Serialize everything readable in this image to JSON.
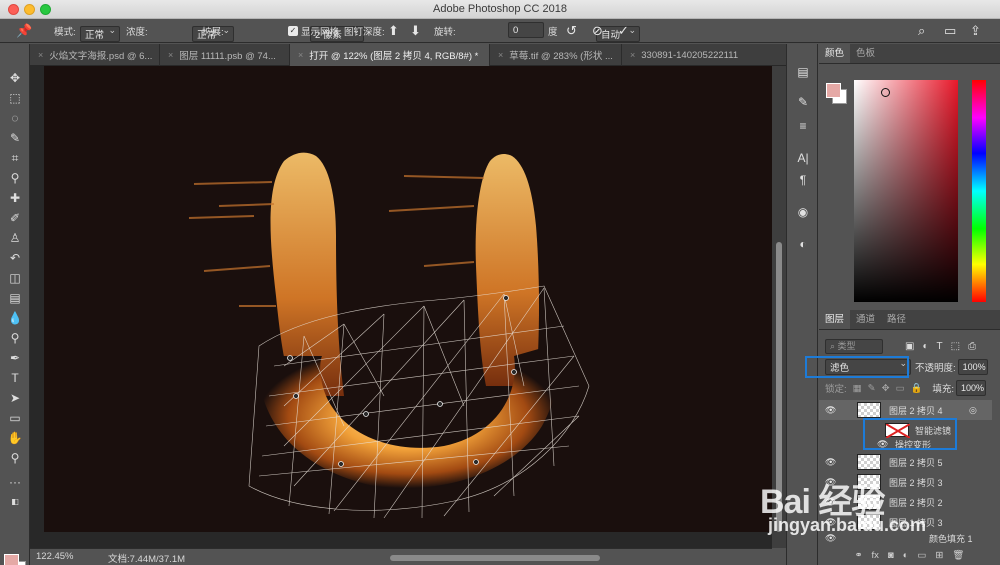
{
  "app": {
    "title": "Adobe Photoshop CC 2018"
  },
  "options": {
    "mode_label": "模式:",
    "mode_value": "正常",
    "density_label": "浓度:",
    "density_value": "正常",
    "expand_label": "扩展:",
    "expand_value": "2 像素",
    "show_mesh_label": "显示网格",
    "pin_depth_label": "图钉深度:",
    "rotate_label": "旋转:",
    "rotate_value": "自动",
    "angle_value": "0",
    "angle_unit": "度"
  },
  "tabs": [
    {
      "label": "火焰文字海报.psd @ 6..."
    },
    {
      "label": "图层 11111.psb @ 74..."
    },
    {
      "label": "打开 @ 122% (图层 2 拷贝 4, RGB/8#) *"
    },
    {
      "label": "草莓.tif @ 283% (形状 ..."
    },
    {
      "label": "330891-140205222111"
    }
  ],
  "status": {
    "zoom": "122.45%",
    "doc": "文档:7.44M/37.1M"
  },
  "color_panel": {
    "tabs": [
      "颜色",
      "色板"
    ],
    "fg": "#e5a9a6",
    "bg": "#ffffff"
  },
  "layers_panel": {
    "tabs": [
      "图层",
      "通道",
      "路径"
    ],
    "search_placeholder": "类型",
    "blend_mode": "滤色",
    "opacity_label": "不透明度:",
    "opacity_value": "100%",
    "lock_label": "锁定:",
    "fill_label": "填充:",
    "fill_value": "100%",
    "layers": [
      {
        "name": "图层 2 拷贝 4"
      },
      {
        "name": "智能滤镜"
      },
      {
        "name": "操控变形"
      },
      {
        "name": "图层 2 拷贝 5"
      },
      {
        "name": "图层 2 拷贝 3"
      },
      {
        "name": "图层 2 拷贝 2"
      },
      {
        "name": "图层 1 拷贝 3"
      },
      {
        "name": "颜色填充 1"
      }
    ]
  },
  "watermark": {
    "text": "Bai 经验",
    "url": "jingyan.baidu.com"
  }
}
